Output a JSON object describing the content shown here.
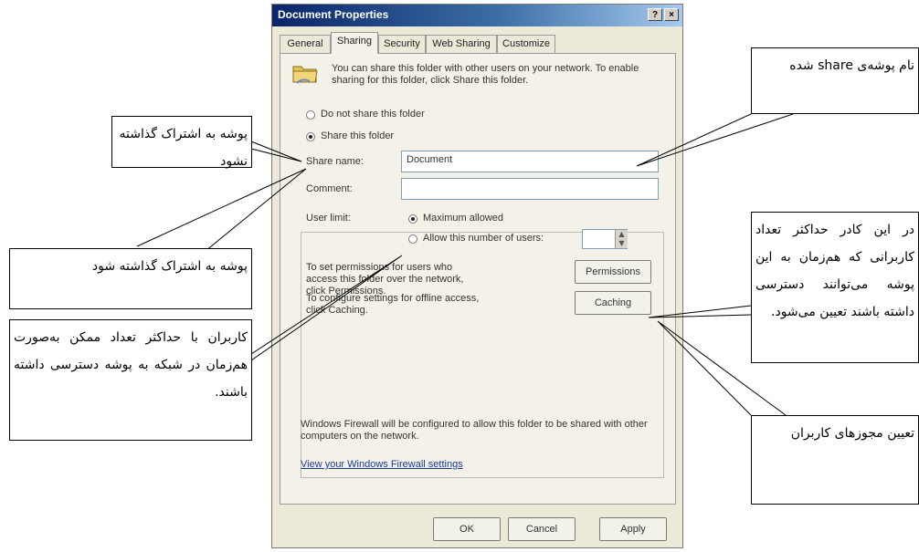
{
  "dialog": {
    "title": "Document Properties",
    "title_buttons": {
      "help": "?",
      "close": "×"
    },
    "tabs": [
      {
        "label": "General",
        "active": false
      },
      {
        "label": "Sharing",
        "active": true
      },
      {
        "label": "Security",
        "active": false
      },
      {
        "label": "Web Sharing",
        "active": false
      },
      {
        "label": "Customize",
        "active": false
      }
    ],
    "intro_text": "You can share this folder with other users on your network. To enable sharing for this folder, click Share this folder.",
    "radio_do_not_share": "Do not share this folder",
    "radio_share": "Share this folder",
    "share_name_label": "Share name:",
    "share_name_value": "Document",
    "comment_label": "Comment:",
    "comment_value": "",
    "user_limit_label": "User limit:",
    "radio_max_allowed": "Maximum allowed",
    "radio_allow_number": "Allow this number of users:",
    "permissions_text": "To set permissions for users who access this folder over the network, click Permissions.",
    "permissions_button": "Permissions",
    "caching_text": "To configure settings for offline access, click Caching.",
    "caching_button": "Caching",
    "firewall_text": "Windows Firewall will be configured to allow this folder to be shared with other computers on the network.",
    "firewall_link": "View your Windows Firewall settings",
    "ok_button": "OK",
    "cancel_button": "Cancel",
    "apply_button": "Apply"
  },
  "callouts": {
    "share_name": "نام پوشه‌ی share شده",
    "do_not_share": "پوشه به اشتراک گذاشته نشود",
    "share": "پوشه به اشتراک گذاشته شود",
    "max_allowed": "کاربران با حداکثر تعداد ممکن به‌صورت هم‌زمان در شبکه به پوشه دسترسی داشته باشند.",
    "user_count": "در این کادر حداکثر تعداد کاربرانی که هم‌زمان به این پوشه می‌توانند دسترسی داشته باشند تعیین می‌شود.",
    "permissions": "تعیین مجوزهای کاربران"
  }
}
